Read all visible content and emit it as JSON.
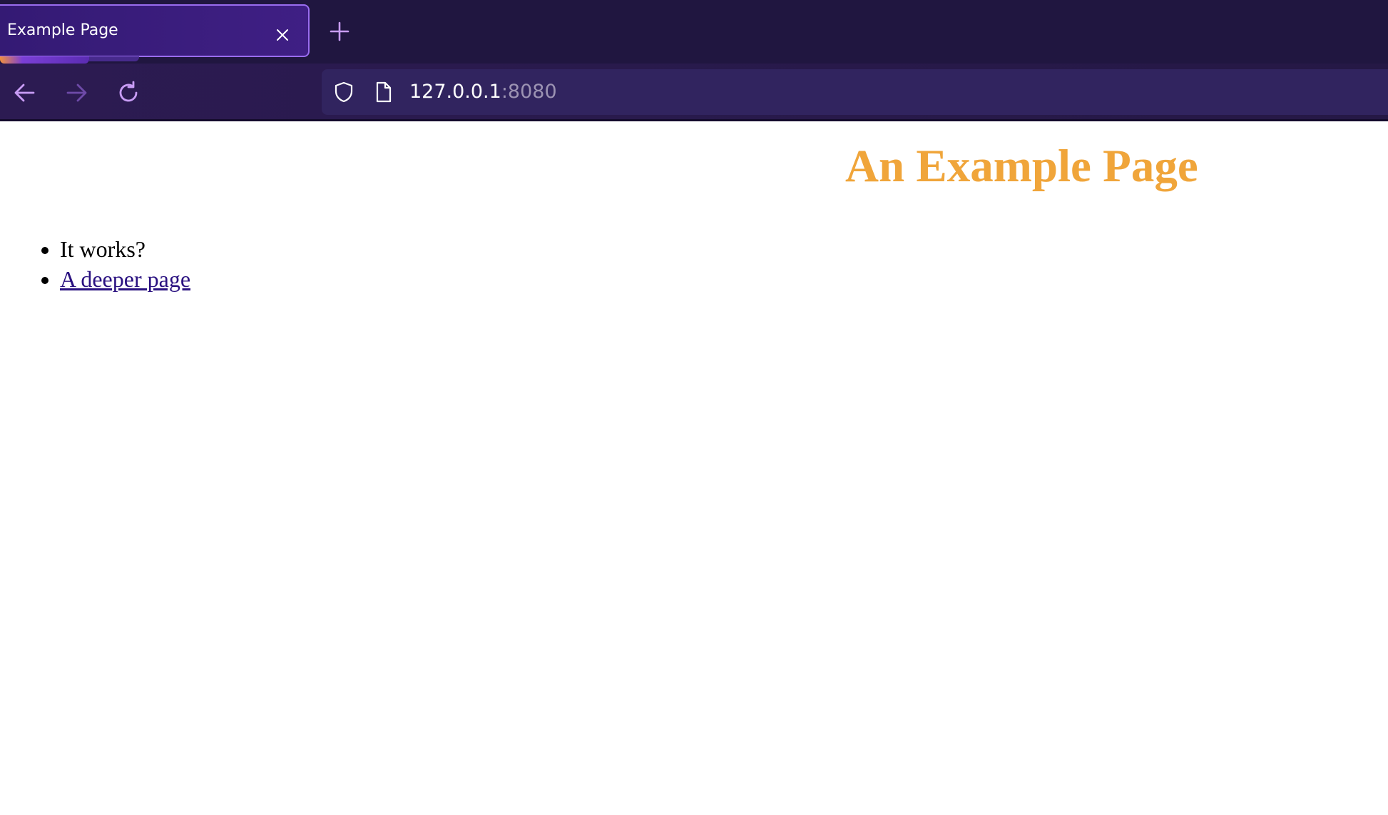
{
  "browser": {
    "tab": {
      "title": "Example Page",
      "close_icon": "close-icon"
    },
    "new_tab_icon": "plus-icon",
    "nav": {
      "back_icon": "arrow-left-icon",
      "forward_icon": "arrow-right-icon",
      "reload_icon": "reload-icon"
    },
    "address_bar": {
      "shield_icon": "shield-icon",
      "page_icon": "document-icon",
      "host": "127.0.0.1",
      "port": ":8080"
    },
    "colors": {
      "tab_strip": "#201640",
      "active_tab": "#3a1d7c",
      "tab_border": "#9a6df0",
      "icon_accent": "#c89cf5",
      "url_bar": "#31245f"
    }
  },
  "page": {
    "title": "An Example Page",
    "title_color": "#f0a53a",
    "list": [
      {
        "text": "It works?",
        "is_link": false
      },
      {
        "text": "A deeper page",
        "is_link": true
      }
    ],
    "link_color": "#2a1180"
  }
}
